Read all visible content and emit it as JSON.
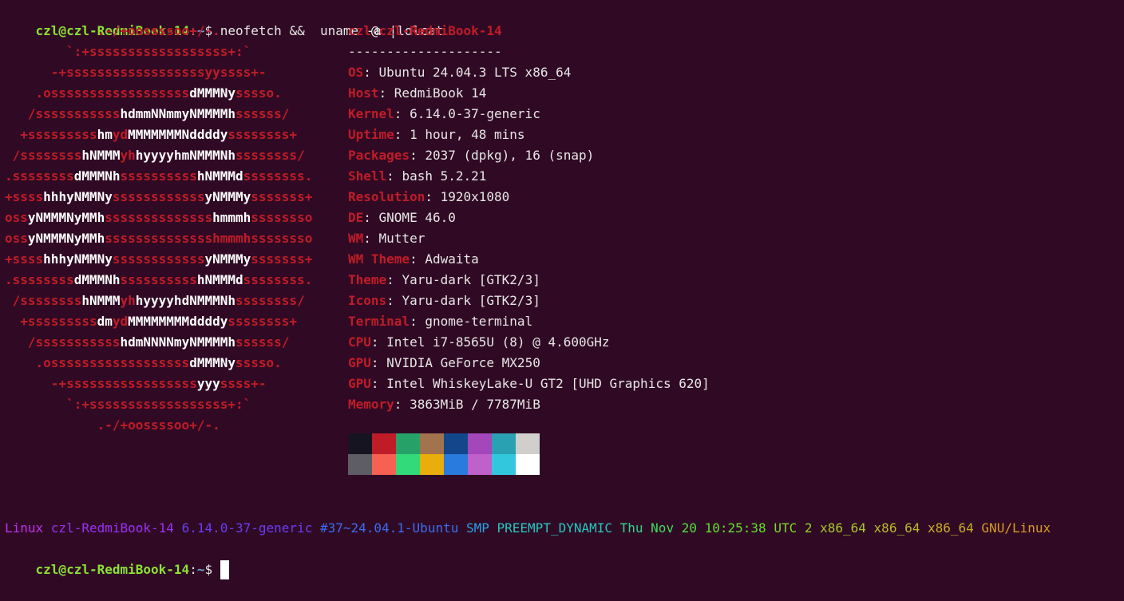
{
  "terminal": {
    "prompt_user": "czl@czl-RedmiBook-14",
    "prompt_sep": ":",
    "prompt_path": "~",
    "prompt_symbol": "$",
    "command": " neofetch &&  uname -a |lolcat"
  },
  "ascii": [
    [
      [
        "r",
        "            .-/+oossssoo+/-.            "
      ]
    ],
    [
      [
        "r",
        "        `:+ssssssssssssssssss+:`        "
      ]
    ],
    [
      [
        "r",
        "      -+ssssssssssssssssssyyssss+-      "
      ]
    ],
    [
      [
        "r",
        "    .ossssssssssssssssss"
      ],
      [
        "w",
        "dMMMNy"
      ],
      [
        "r",
        "sssso.    "
      ]
    ],
    [
      [
        "r",
        "   /sssssssssss"
      ],
      [
        "w",
        "hdmmNNmmyNMMMMh"
      ],
      [
        "r",
        "ssssss/   "
      ]
    ],
    [
      [
        "r",
        "  +sssssssss"
      ],
      [
        "w",
        "hm"
      ],
      [
        "r",
        "yd"
      ],
      [
        "w",
        "MMMMMMMNddddy"
      ],
      [
        "r",
        "ssssssss+  "
      ]
    ],
    [
      [
        "r",
        " /ssssssss"
      ],
      [
        "w",
        "hNMMM"
      ],
      [
        "r",
        "yh"
      ],
      [
        "w",
        "hyyyyhmNMMMNh"
      ],
      [
        "r",
        "ssssssss/ "
      ]
    ],
    [
      [
        "r",
        ".ssssssss"
      ],
      [
        "w",
        "dMMMNh"
      ],
      [
        "r",
        "ssssssssss"
      ],
      [
        "w",
        "hNMMMd"
      ],
      [
        "r",
        "ssssssss."
      ]
    ],
    [
      [
        "r",
        "+ssss"
      ],
      [
        "w",
        "hhhyNMMNy"
      ],
      [
        "r",
        "ssssssssssss"
      ],
      [
        "w",
        "yNMMMy"
      ],
      [
        "r",
        "sssssss+"
      ]
    ],
    [
      [
        "r",
        "oss"
      ],
      [
        "w",
        "yNMMMNyMMh"
      ],
      [
        "r",
        "ssssssssssssss"
      ],
      [
        "w",
        "hmmmh"
      ],
      [
        "r",
        "ssssssso"
      ]
    ],
    [
      [
        "r",
        "oss"
      ],
      [
        "w",
        "yNMMMNyMMh"
      ],
      [
        "r",
        "sssssssssssssshmmmhssssssso"
      ]
    ],
    [
      [
        "r",
        "+ssss"
      ],
      [
        "w",
        "hhhyNMMNy"
      ],
      [
        "r",
        "ssssssssssss"
      ],
      [
        "w",
        "yNMMMy"
      ],
      [
        "r",
        "sssssss+"
      ]
    ],
    [
      [
        "r",
        ".ssssssss"
      ],
      [
        "w",
        "dMMMNh"
      ],
      [
        "r",
        "ssssssssss"
      ],
      [
        "w",
        "hNMMMd"
      ],
      [
        "r",
        "ssssssss."
      ]
    ],
    [
      [
        "r",
        " /ssssssss"
      ],
      [
        "w",
        "hNMMM"
      ],
      [
        "r",
        "yh"
      ],
      [
        "w",
        "hyyyyhdNMMMNh"
      ],
      [
        "r",
        "ssssssss/ "
      ]
    ],
    [
      [
        "r",
        "  +sssssssss"
      ],
      [
        "w",
        "dm"
      ],
      [
        "r",
        "yd"
      ],
      [
        "w",
        "MMMMMMMMddddy"
      ],
      [
        "r",
        "ssssssss+  "
      ]
    ],
    [
      [
        "r",
        "   /sssssssssss"
      ],
      [
        "w",
        "hdmNNNNmyNMMMMh"
      ],
      [
        "r",
        "ssssss/   "
      ]
    ],
    [
      [
        "r",
        "    .ossssssssssssssssss"
      ],
      [
        "w",
        "dMMMNy"
      ],
      [
        "r",
        "sssso.    "
      ]
    ],
    [
      [
        "r",
        "      -+sssssssssssssssss"
      ],
      [
        "w",
        "yyy"
      ],
      [
        "r",
        "ssss+-      "
      ]
    ],
    [
      [
        "r",
        "        `:+ssssssssssssssssss+:`        "
      ]
    ],
    [
      [
        "r",
        "            .-/+oossssoo+/-.            "
      ]
    ]
  ],
  "info": {
    "title_user": "czl",
    "title_at": "@",
    "title_host": "czl-RedmiBook-14",
    "separator": "--------------------",
    "rows": [
      {
        "key": "OS",
        "value": "Ubuntu 24.04.3 LTS x86_64"
      },
      {
        "key": "Host",
        "value": "RedmiBook 14"
      },
      {
        "key": "Kernel",
        "value": "6.14.0-37-generic"
      },
      {
        "key": "Uptime",
        "value": "1 hour, 48 mins"
      },
      {
        "key": "Packages",
        "value": "2037 (dpkg), 16 (snap)"
      },
      {
        "key": "Shell",
        "value": "bash 5.2.21"
      },
      {
        "key": "Resolution",
        "value": "1920x1080"
      },
      {
        "key": "DE",
        "value": "GNOME 46.0"
      },
      {
        "key": "WM",
        "value": "Mutter"
      },
      {
        "key": "WM Theme",
        "value": "Adwaita"
      },
      {
        "key": "Theme",
        "value": "Yaru-dark [GTK2/3]"
      },
      {
        "key": "Icons",
        "value": "Yaru-dark [GTK2/3]"
      },
      {
        "key": "Terminal",
        "value": "gnome-terminal"
      },
      {
        "key": "CPU",
        "value": "Intel i7-8565U (8) @ 4.600GHz"
      },
      {
        "key": "GPU",
        "value": "NVIDIA GeForce MX250"
      },
      {
        "key": "GPU",
        "value": "Intel WhiskeyLake-U GT2 [UHD Graphics 620]"
      },
      {
        "key": "Memory",
        "value": "3863MiB / 7787MiB"
      }
    ]
  },
  "palette": [
    "#171421",
    "#c01c28",
    "#26a269",
    "#a2734c",
    "#12488b",
    "#a347ba",
    "#2aa1b3",
    "#d0cfcc",
    "#5e5c64",
    "#f66151",
    "#33da7a",
    "#e9ad0c",
    "#2a7bde",
    "#c061cb",
    "#33c7de",
    "#ffffff"
  ],
  "uname_output": [
    {
      "text": "Linux ",
      "color": "#c22ff0"
    },
    {
      "text": "czl-RedmiBook-14 ",
      "color": "#9b30f5"
    },
    {
      "text": "6.14.0-37-generic ",
      "color": "#6a3df5"
    },
    {
      "text": "#37~24.04.1-Ubuntu ",
      "color": "#3b6cf0"
    },
    {
      "text": "SMP ",
      "color": "#2b9ee8"
    },
    {
      "text": "PREEMPT_DYNAMIC ",
      "color": "#26c6c2"
    },
    {
      "text": "Thu ",
      "color": "#33d38a"
    },
    {
      "text": "Nov ",
      "color": "#3fdc5c"
    },
    {
      "text": "20 ",
      "color": "#4fe03e"
    },
    {
      "text": "10:25:38 ",
      "color": "#62e02e"
    },
    {
      "text": "UTC ",
      "color": "#7ed82a"
    },
    {
      "text": "2 ",
      "color": "#93d02a"
    },
    {
      "text": "x86_64 ",
      "color": "#a5c82a"
    },
    {
      "text": "x86_64 ",
      "color": "#b8bc2a"
    },
    {
      "text": "x86_64 ",
      "color": "#c9ac28"
    },
    {
      "text": "GNU/Linux",
      "color": "#d89a26"
    }
  ]
}
